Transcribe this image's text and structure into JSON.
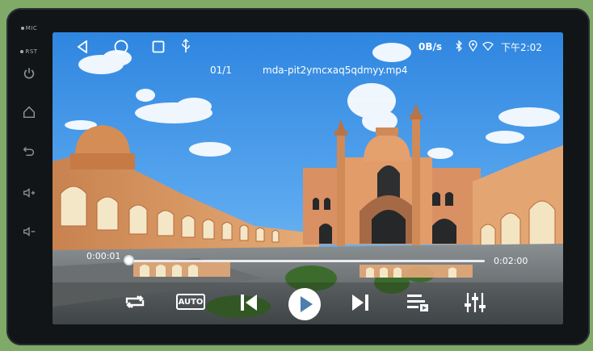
{
  "side_panel": {
    "mic_label": "MIC",
    "rst_label": "RST"
  },
  "status_bar": {
    "net_speed": "0B/s",
    "time": "下午2:02",
    "icons": [
      "back-icon",
      "home-icon",
      "recents-icon",
      "usb-icon",
      "bluetooth-icon",
      "location-icon",
      "wifi-icon"
    ]
  },
  "player": {
    "track_index": "01/1",
    "file_name": "mda-pit2ymcxaq5qdmyy.mp4",
    "current_time": "0:00:01",
    "total_time": "0:02:00",
    "progress": 0.008,
    "auto_label": "AUTO",
    "controls": [
      "repeat-icon",
      "auto-mode-button",
      "previous-icon",
      "play-icon",
      "next-icon",
      "playlist-icon",
      "equalizer-icon"
    ]
  },
  "colors": {
    "accent": "#4aa3ff",
    "sky": "#3c8de0",
    "frame": "#121517",
    "wall": "#e1a572"
  }
}
